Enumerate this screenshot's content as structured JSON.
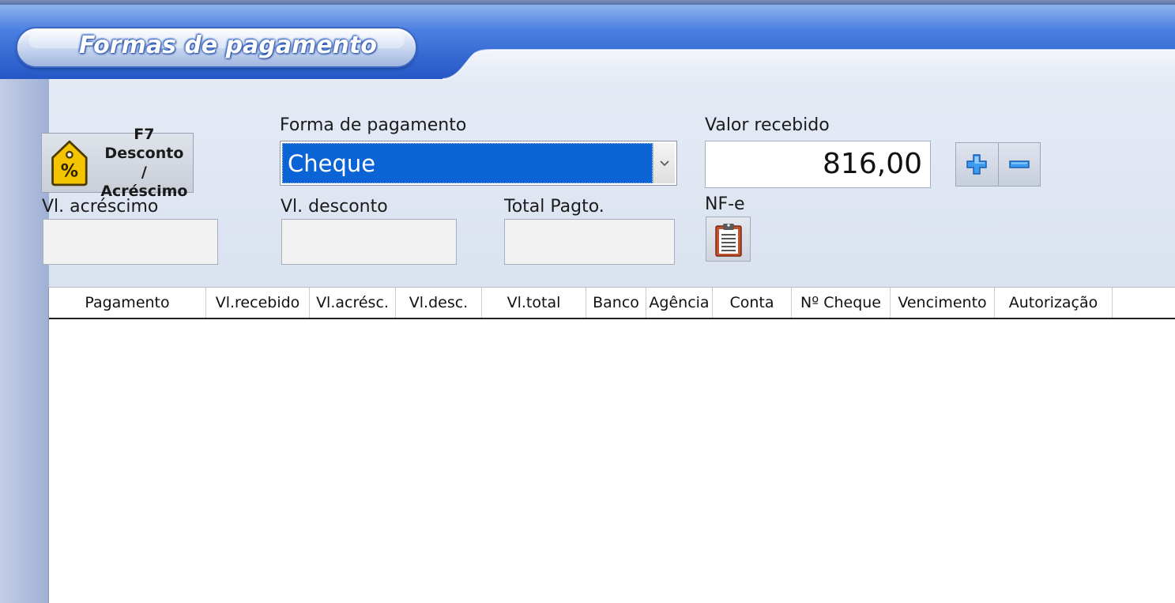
{
  "window": {
    "title": "Formas de pagamento"
  },
  "discount_button": {
    "label_line1": "F7 Desconto",
    "label_line2": "/ Acréscimo",
    "icon": "percent-tag-icon"
  },
  "forma_pagamento": {
    "label": "Forma de pagamento",
    "selected": "Cheque"
  },
  "valor_recebido": {
    "label": "Valor recebido",
    "value": "816,00"
  },
  "add_remove": {
    "add_icon": "plus-icon",
    "remove_icon": "minus-icon"
  },
  "fields": {
    "acrescimo_label": "Vl. acréscimo",
    "acrescimo_value": "",
    "desconto_label": "Vl. desconto",
    "desconto_value": "",
    "total_label": "Total Pagto.",
    "total_value": ""
  },
  "nfe": {
    "label": "NF-e",
    "icon": "clipboard-icon"
  },
  "grid": {
    "columns": [
      "Pagamento",
      "Vl.recebido",
      "Vl.acrésc.",
      "Vl.desc.",
      "Vl.total",
      "Banco",
      "Agência",
      "Conta",
      "Nº Cheque",
      "Vencimento",
      "Autorização"
    ],
    "rows": []
  },
  "colors": {
    "header_blue": "#2a5cc8",
    "selection_blue": "#0a64d6",
    "tag_yellow": "#f5c400",
    "plus_minus_blue": "#2f8be0"
  }
}
